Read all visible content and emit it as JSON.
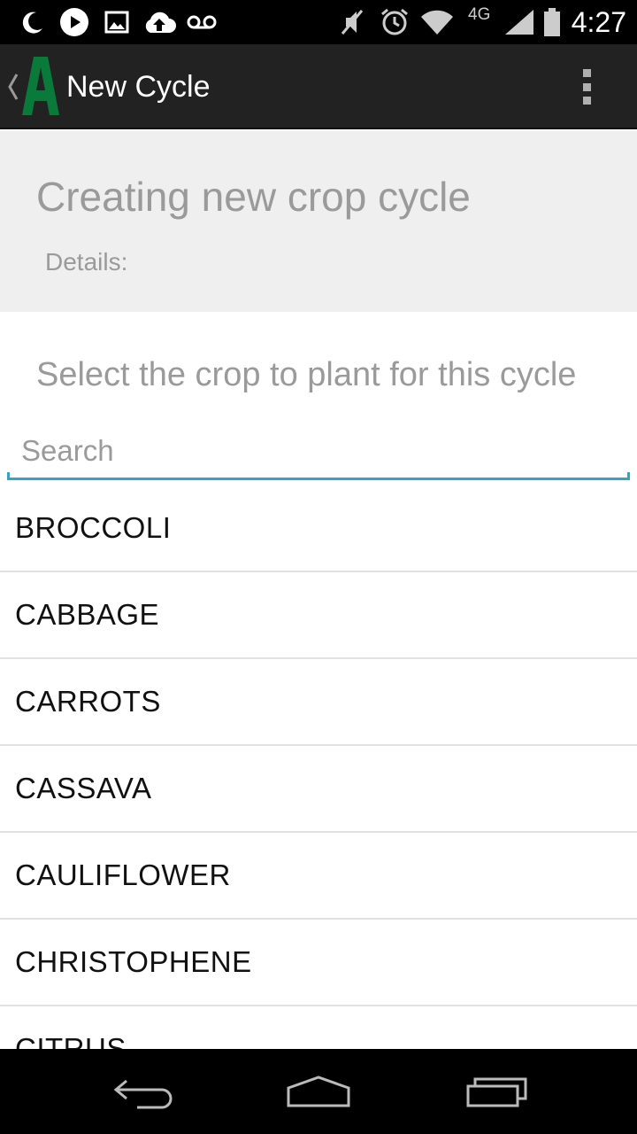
{
  "status_bar": {
    "time": "4:27",
    "network": "4G",
    "icons": [
      "moon-icon",
      "play-icon",
      "image-icon",
      "cloud-upload-icon",
      "voicemail-icon",
      "mute-icon",
      "alarm-icon",
      "wifi-icon",
      "signal-icon",
      "battery-icon"
    ]
  },
  "action_bar": {
    "title": "New Cycle",
    "logo_letter": "A",
    "brand_color": "#0a7a3a",
    "icons": [
      "up-caret-icon",
      "app-logo-icon",
      "overflow-menu-icon"
    ]
  },
  "header": {
    "title": "Creating new crop cycle",
    "details_label": "Details:"
  },
  "content": {
    "prompt": "Select the crop to plant for this cycle",
    "search_placeholder": "Search",
    "search_value": ""
  },
  "crops": [
    {
      "label": "BROCCOLI"
    },
    {
      "label": "CABBAGE"
    },
    {
      "label": "CARROTS"
    },
    {
      "label": "CASSAVA"
    },
    {
      "label": "CAULIFLOWER"
    },
    {
      "label": "CHRISTOPHENE"
    },
    {
      "label": "CITRUS"
    }
  ],
  "nav_bar": {
    "icons": [
      "back-icon",
      "home-icon",
      "recents-icon"
    ]
  },
  "colors": {
    "accent": "#33a4c9",
    "action_bar": "#222222",
    "header_bg": "#efefef"
  }
}
